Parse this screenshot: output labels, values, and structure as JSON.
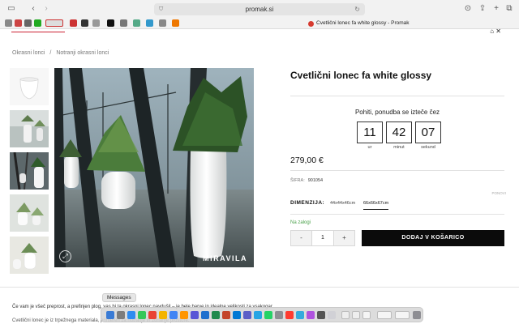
{
  "browser": {
    "url": "promak.si",
    "active_tab_title": "Cvetlični lonec fa white glossy - Promak",
    "icons": [
      "sidebar-icon",
      "back-icon",
      "forward-icon",
      "shield-icon",
      "download-icon",
      "share-icon",
      "new-tab-icon",
      "tabs-overview-icon"
    ]
  },
  "breadcrumb": {
    "items": [
      "Okrasni lonci",
      "Notranji okrasni lonci"
    ]
  },
  "product": {
    "title": "Cvetlični lonec fa white glossy",
    "brand_watermark": "MIRAVILA",
    "promo_text": "Pohiti, ponudba se izteče čez",
    "countdown": {
      "hours": "11",
      "hours_label": "ur",
      "minutes": "42",
      "minutes_label": "minut",
      "seconds": "07",
      "seconds_label": "sekund"
    },
    "price": "279,00 €",
    "sku_label": "ŠIFRA:",
    "sku_value": "901054",
    "reset_label": "PONOVI",
    "dimension_label": "DIMENZIJA:",
    "dimension_options": [
      "44x44x46cm",
      "66x66x67cm"
    ],
    "dimension_selected": "66x66x67cm",
    "stock_status": "Na zalogi",
    "quantity": "1",
    "minus_label": "-",
    "plus_label": "+",
    "add_to_cart_label": "DODAJ V KOŠARICO"
  },
  "description": {
    "line1": "Če vam je všeč preprost, a prefinjen plog, vas bi ta okrasni lonec navdušil – je bele barve in idealne velikosti za vsakogar.",
    "line2": "Cvetlični lonec je iz trpežnega materiala, primeren za notranje in zunanje prostore."
  },
  "dock": {
    "tooltip": "Messages"
  },
  "colors": {
    "accent_black": "#0b0b0b",
    "stock_green": "#4aa14a",
    "logo_red": "#cc2233"
  }
}
